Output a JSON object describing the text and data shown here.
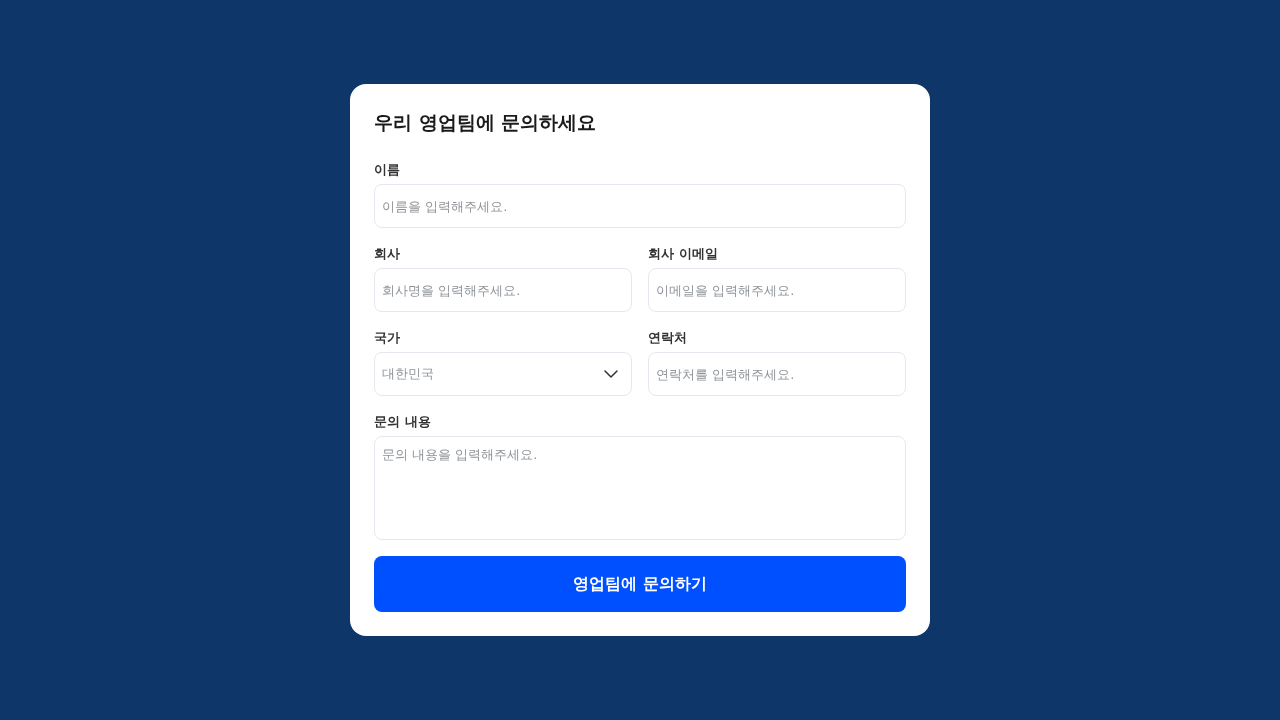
{
  "form": {
    "title": "우리 영업팀에 문의하세요",
    "rows": [
      [
        {
          "kind": "input",
          "label": "이름",
          "placeholder": "이름을 입력해주세요."
        }
      ],
      [
        {
          "kind": "input",
          "label": "회사",
          "placeholder": "회사명을 입력해주세요."
        },
        {
          "kind": "input",
          "label": "회사 이메일",
          "placeholder": "이메일을 입력해주세요."
        }
      ],
      [
        {
          "kind": "select",
          "label": "국가",
          "value": "대한민국"
        },
        {
          "kind": "input",
          "label": "연락처",
          "placeholder": "연락처를 입력해주세요."
        }
      ],
      [
        {
          "kind": "textarea",
          "label": "문의 내용",
          "placeholder": "문의 내용을 입력해주세요."
        }
      ]
    ],
    "submit_button": {
      "label": "영업팀에 문의하기"
    }
  }
}
